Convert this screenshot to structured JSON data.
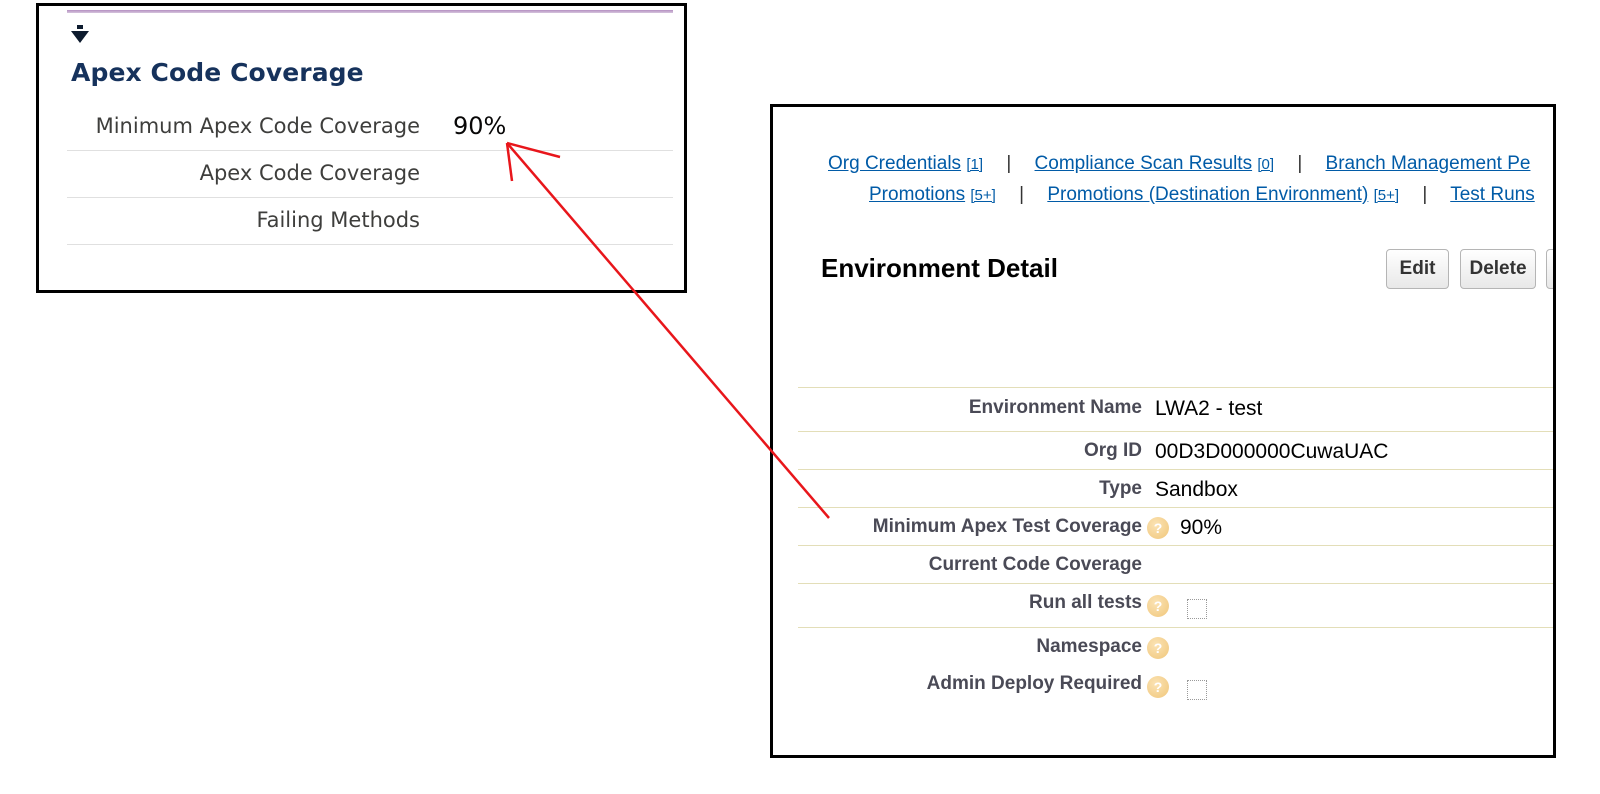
{
  "left_panel": {
    "section_title": "Apex Code Coverage",
    "rows": [
      {
        "label": "Minimum Apex Code Coverage",
        "value": "90%"
      },
      {
        "label": "Apex Code Coverage",
        "value": ""
      },
      {
        "label": "Failing Methods",
        "value": ""
      }
    ]
  },
  "right_panel": {
    "related_links_row1": [
      {
        "label": "Org Credentials",
        "count": "[1]"
      },
      {
        "label": "Compliance Scan Results",
        "count": "[0]"
      },
      {
        "label": "Branch Management Pe",
        "count": ""
      }
    ],
    "related_links_row2": [
      {
        "label": "Promotions",
        "count": "[5+]"
      },
      {
        "label": "Promotions (Destination Environment)",
        "count": "[5+]"
      },
      {
        "label": "Test Runs",
        "count": ""
      }
    ],
    "separator": "|",
    "detail_title": "Environment Detail",
    "buttons": {
      "edit": "Edit",
      "delete": "Delete"
    },
    "fields": [
      {
        "label": "Environment Name",
        "value": "LWA2 - test",
        "help": false,
        "checkbox": false
      },
      {
        "label": "Org ID",
        "value": "00D3D000000CuwaUAC",
        "help": false,
        "checkbox": false
      },
      {
        "label": "Type",
        "value": "Sandbox",
        "help": false,
        "checkbox": false
      },
      {
        "label": "Minimum Apex Test Coverage",
        "value": "90%",
        "help": true,
        "checkbox": false
      },
      {
        "label": "Current Code Coverage",
        "value": "",
        "help": false,
        "checkbox": false
      },
      {
        "label": "Run all tests",
        "value": "",
        "help": true,
        "checkbox": true
      },
      {
        "label": "Namespace",
        "value": "",
        "help": true,
        "checkbox": false
      },
      {
        "label": "Admin Deploy Required",
        "value": "",
        "help": true,
        "checkbox": true
      }
    ],
    "help_glyph": "?"
  },
  "annotation": {
    "arrow_color": "#e8161b"
  }
}
